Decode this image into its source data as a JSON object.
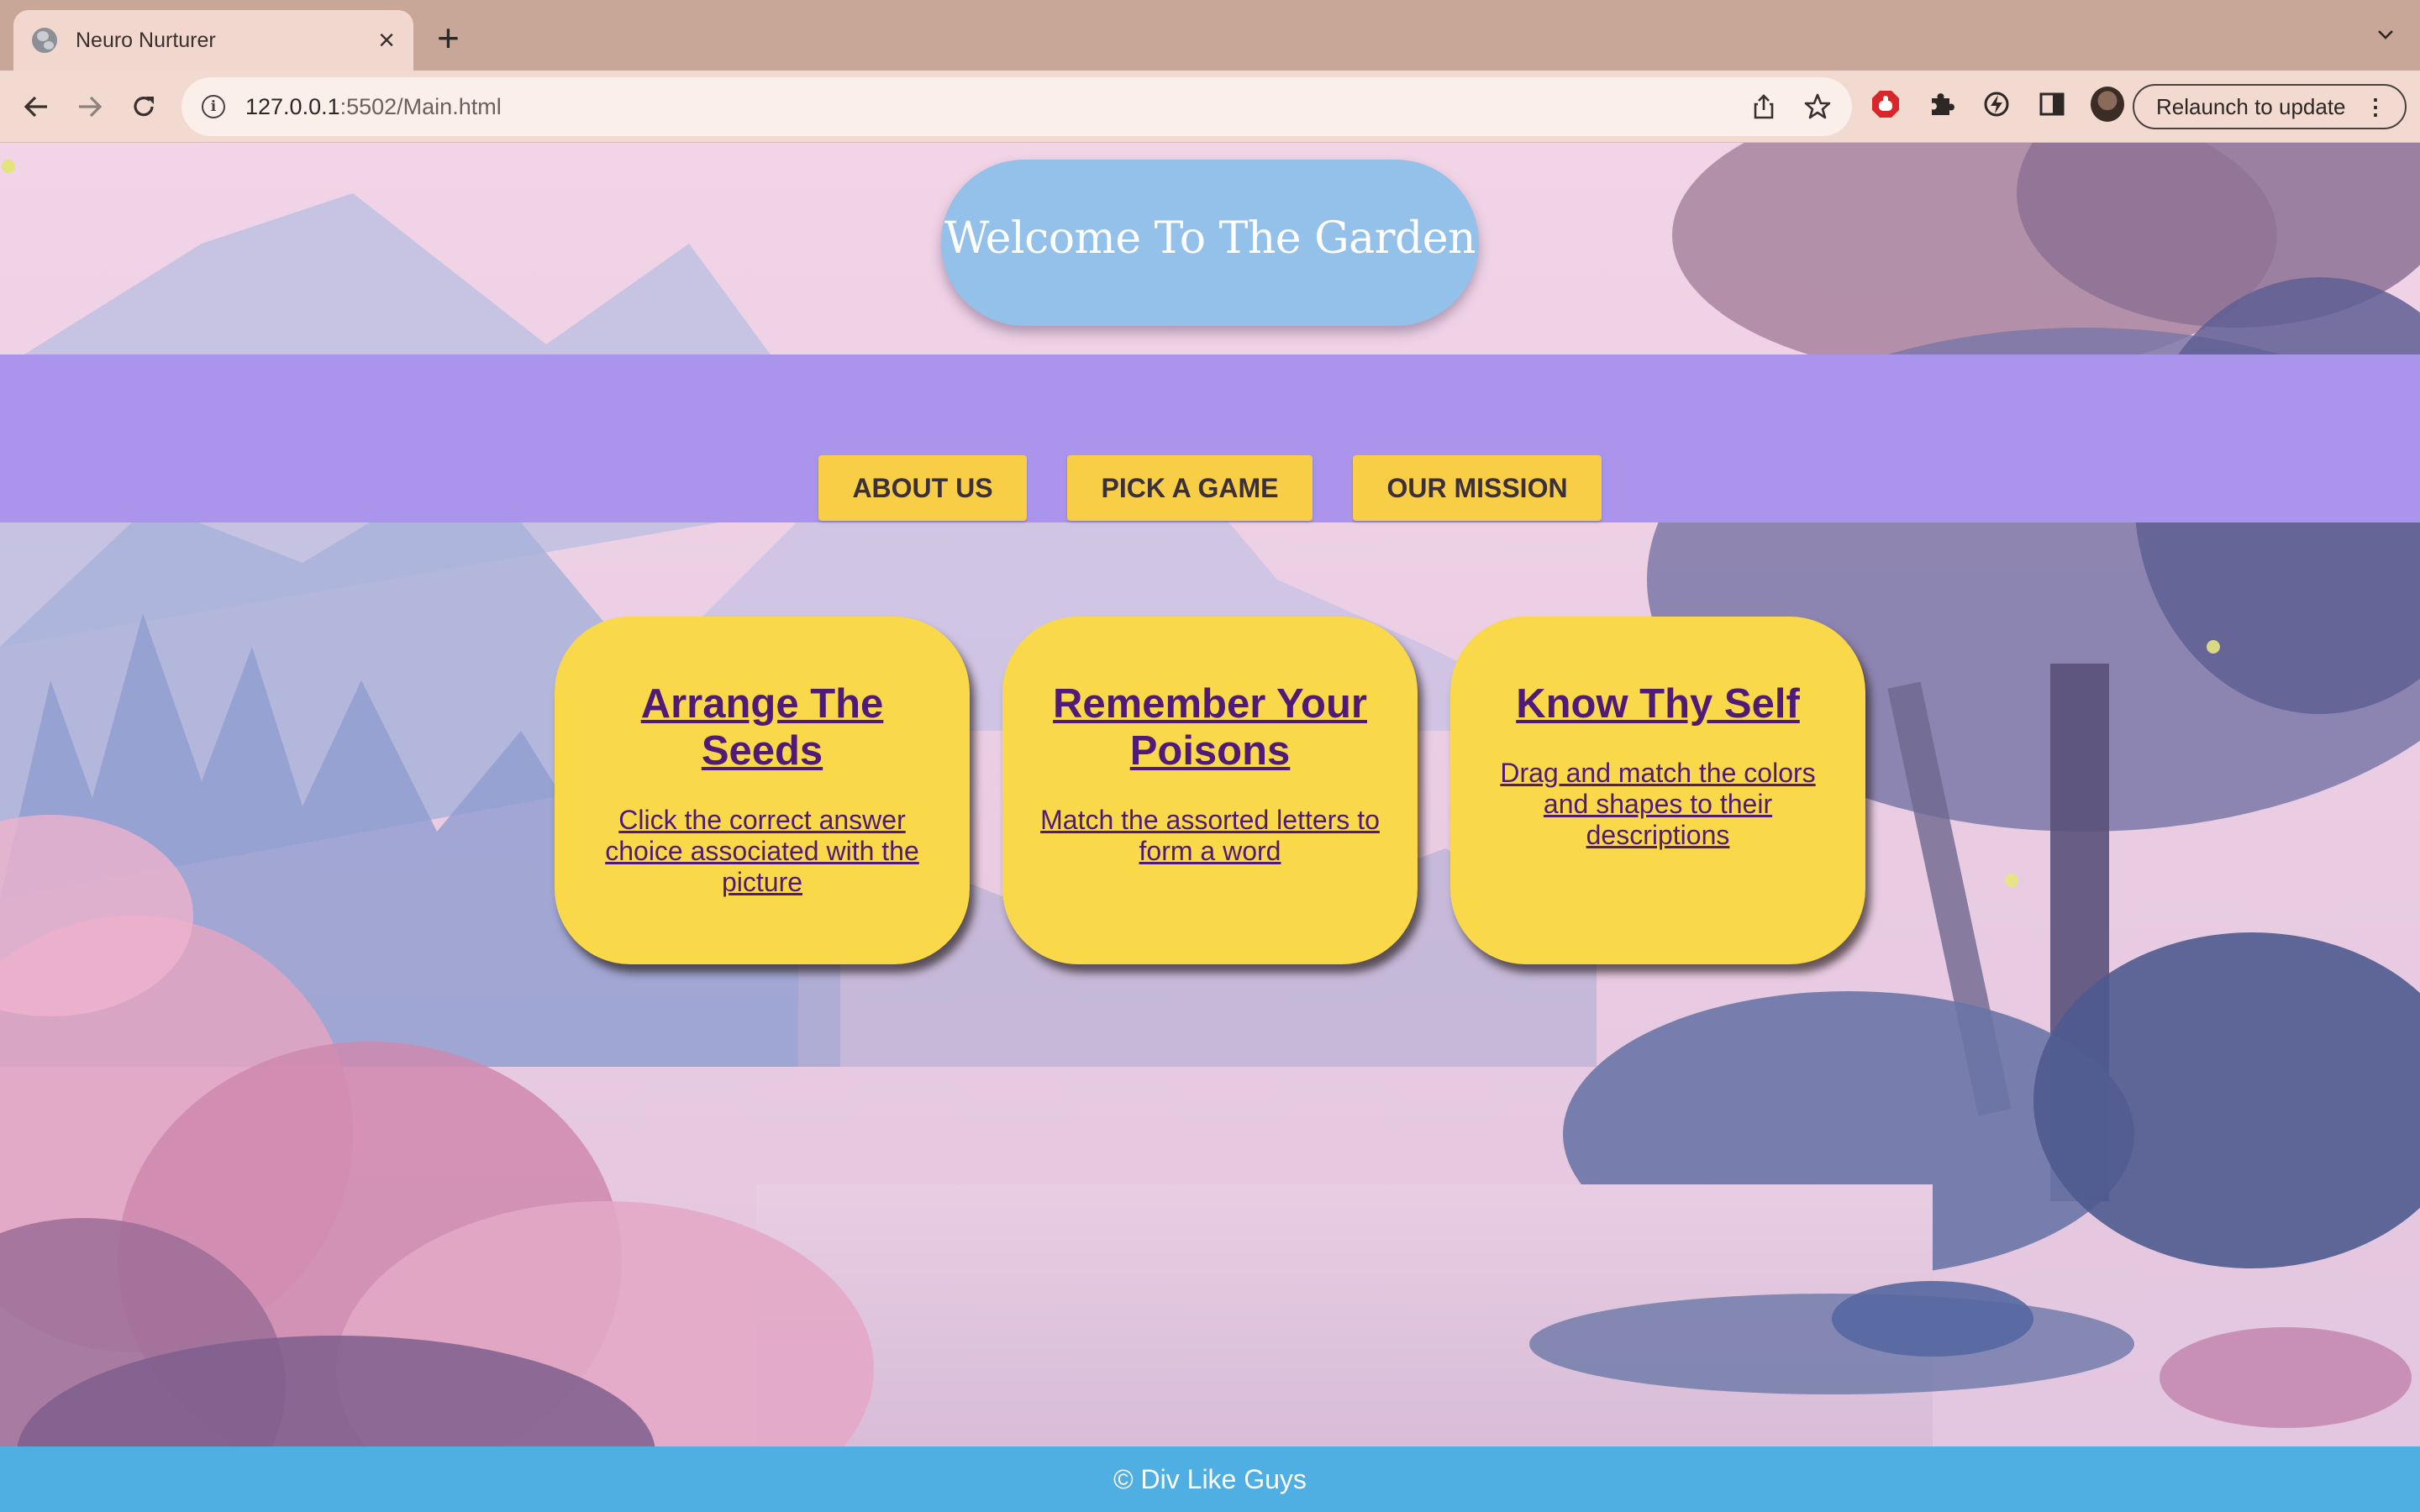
{
  "browser": {
    "tab": {
      "title": "Neuro Nurturer",
      "close_glyph": "×",
      "favicon": "globe-icon"
    },
    "new_tab_glyph": "+",
    "url": {
      "host": "127.0.0.1",
      "rest": ":5502/Main.html"
    },
    "info_glyph": "i",
    "relaunch_label": "Relaunch to update",
    "menu_glyph": "⋮"
  },
  "page": {
    "header_title": "Welcome To The Garden",
    "nav": [
      {
        "label": "ABOUT US"
      },
      {
        "label": "PICK A GAME"
      },
      {
        "label": "OUR MISSION"
      }
    ],
    "games": [
      {
        "title": "Arrange The Seeds",
        "description": "Click the correct answer choice associated with the picture"
      },
      {
        "title": "Remember Your Poisons",
        "description": "Match the assorted letters to form a word"
      },
      {
        "title": "Know Thy Self",
        "description": "Drag and match the colors and shapes to their descriptions"
      }
    ],
    "footer": "© Div Like Guys"
  },
  "colors": {
    "header_pill": "#94c1ea",
    "nav_band": "#ab95ec",
    "button": "#f7ce45",
    "card": "#f9d84a",
    "card_text": "#4f1a78",
    "footer": "#4faee2"
  }
}
